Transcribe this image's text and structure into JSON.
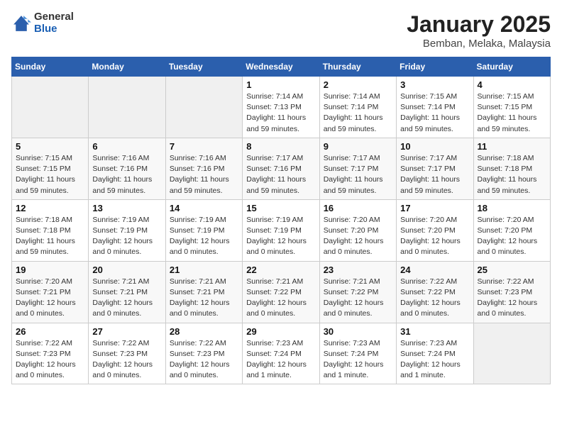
{
  "header": {
    "logo": {
      "general": "General",
      "blue": "Blue"
    },
    "title": "January 2025",
    "location": "Bemban, Melaka, Malaysia"
  },
  "weekdays": [
    "Sunday",
    "Monday",
    "Tuesday",
    "Wednesday",
    "Thursday",
    "Friday",
    "Saturday"
  ],
  "weeks": [
    [
      null,
      null,
      null,
      {
        "day": "1",
        "sunrise": "7:14 AM",
        "sunset": "7:13 PM",
        "daylight": "11 hours and 59 minutes."
      },
      {
        "day": "2",
        "sunrise": "7:14 AM",
        "sunset": "7:14 PM",
        "daylight": "11 hours and 59 minutes."
      },
      {
        "day": "3",
        "sunrise": "7:15 AM",
        "sunset": "7:14 PM",
        "daylight": "11 hours and 59 minutes."
      },
      {
        "day": "4",
        "sunrise": "7:15 AM",
        "sunset": "7:15 PM",
        "daylight": "11 hours and 59 minutes."
      }
    ],
    [
      {
        "day": "5",
        "sunrise": "7:15 AM",
        "sunset": "7:15 PM",
        "daylight": "11 hours and 59 minutes."
      },
      {
        "day": "6",
        "sunrise": "7:16 AM",
        "sunset": "7:16 PM",
        "daylight": "11 hours and 59 minutes."
      },
      {
        "day": "7",
        "sunrise": "7:16 AM",
        "sunset": "7:16 PM",
        "daylight": "11 hours and 59 minutes."
      },
      {
        "day": "8",
        "sunrise": "7:17 AM",
        "sunset": "7:16 PM",
        "daylight": "11 hours and 59 minutes."
      },
      {
        "day": "9",
        "sunrise": "7:17 AM",
        "sunset": "7:17 PM",
        "daylight": "11 hours and 59 minutes."
      },
      {
        "day": "10",
        "sunrise": "7:17 AM",
        "sunset": "7:17 PM",
        "daylight": "11 hours and 59 minutes."
      },
      {
        "day": "11",
        "sunrise": "7:18 AM",
        "sunset": "7:18 PM",
        "daylight": "11 hours and 59 minutes."
      }
    ],
    [
      {
        "day": "12",
        "sunrise": "7:18 AM",
        "sunset": "7:18 PM",
        "daylight": "11 hours and 59 minutes."
      },
      {
        "day": "13",
        "sunrise": "7:19 AM",
        "sunset": "7:19 PM",
        "daylight": "12 hours and 0 minutes."
      },
      {
        "day": "14",
        "sunrise": "7:19 AM",
        "sunset": "7:19 PM",
        "daylight": "12 hours and 0 minutes."
      },
      {
        "day": "15",
        "sunrise": "7:19 AM",
        "sunset": "7:19 PM",
        "daylight": "12 hours and 0 minutes."
      },
      {
        "day": "16",
        "sunrise": "7:20 AM",
        "sunset": "7:20 PM",
        "daylight": "12 hours and 0 minutes."
      },
      {
        "day": "17",
        "sunrise": "7:20 AM",
        "sunset": "7:20 PM",
        "daylight": "12 hours and 0 minutes."
      },
      {
        "day": "18",
        "sunrise": "7:20 AM",
        "sunset": "7:20 PM",
        "daylight": "12 hours and 0 minutes."
      }
    ],
    [
      {
        "day": "19",
        "sunrise": "7:20 AM",
        "sunset": "7:21 PM",
        "daylight": "12 hours and 0 minutes."
      },
      {
        "day": "20",
        "sunrise": "7:21 AM",
        "sunset": "7:21 PM",
        "daylight": "12 hours and 0 minutes."
      },
      {
        "day": "21",
        "sunrise": "7:21 AM",
        "sunset": "7:21 PM",
        "daylight": "12 hours and 0 minutes."
      },
      {
        "day": "22",
        "sunrise": "7:21 AM",
        "sunset": "7:22 PM",
        "daylight": "12 hours and 0 minutes."
      },
      {
        "day": "23",
        "sunrise": "7:21 AM",
        "sunset": "7:22 PM",
        "daylight": "12 hours and 0 minutes."
      },
      {
        "day": "24",
        "sunrise": "7:22 AM",
        "sunset": "7:22 PM",
        "daylight": "12 hours and 0 minutes."
      },
      {
        "day": "25",
        "sunrise": "7:22 AM",
        "sunset": "7:23 PM",
        "daylight": "12 hours and 0 minutes."
      }
    ],
    [
      {
        "day": "26",
        "sunrise": "7:22 AM",
        "sunset": "7:23 PM",
        "daylight": "12 hours and 0 minutes."
      },
      {
        "day": "27",
        "sunrise": "7:22 AM",
        "sunset": "7:23 PM",
        "daylight": "12 hours and 0 minutes."
      },
      {
        "day": "28",
        "sunrise": "7:22 AM",
        "sunset": "7:23 PM",
        "daylight": "12 hours and 0 minutes."
      },
      {
        "day": "29",
        "sunrise": "7:23 AM",
        "sunset": "7:24 PM",
        "daylight": "12 hours and 1 minute."
      },
      {
        "day": "30",
        "sunrise": "7:23 AM",
        "sunset": "7:24 PM",
        "daylight": "12 hours and 1 minute."
      },
      {
        "day": "31",
        "sunrise": "7:23 AM",
        "sunset": "7:24 PM",
        "daylight": "12 hours and 1 minute."
      },
      null
    ]
  ],
  "labels": {
    "sunrise": "Sunrise:",
    "sunset": "Sunset:",
    "daylight": "Daylight:"
  }
}
